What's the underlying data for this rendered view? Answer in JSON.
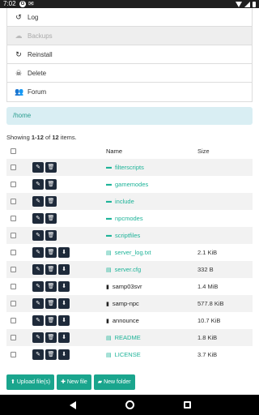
{
  "status_bar": {
    "time": "7:02",
    "g_badge": "G",
    "notif": "✉"
  },
  "menu": [
    {
      "icon": "history-icon",
      "glyph": "↺",
      "label": "Log",
      "disabled": false
    },
    {
      "icon": "cloud-icon",
      "glyph": "☁",
      "label": "Backups",
      "disabled": true
    },
    {
      "icon": "reinstall-icon",
      "glyph": "↻",
      "label": "Reinstall",
      "disabled": false
    },
    {
      "icon": "skull-icon",
      "glyph": "☠",
      "label": "Delete",
      "disabled": false
    },
    {
      "icon": "users-icon",
      "glyph": "👥",
      "label": "Forum",
      "disabled": false
    }
  ],
  "path": "/home",
  "showing": {
    "prefix": "Showing ",
    "range": "1-12",
    "of": " of ",
    "total": "12",
    "suffix": " items."
  },
  "table": {
    "headers": {
      "name": "Name",
      "size": "Size"
    },
    "rows": [
      {
        "type": "folder",
        "name": "filterscripts",
        "size": ""
      },
      {
        "type": "folder",
        "name": "gamemodes",
        "size": ""
      },
      {
        "type": "folder",
        "name": "include",
        "size": ""
      },
      {
        "type": "folder",
        "name": "npcmodes",
        "size": ""
      },
      {
        "type": "folder",
        "name": "scriptfiles",
        "size": ""
      },
      {
        "type": "file-text",
        "name": "server_log.txt",
        "size": "2.1 KiB"
      },
      {
        "type": "file-text",
        "name": "server.cfg",
        "size": "332 B"
      },
      {
        "type": "file",
        "name": "samp03svr",
        "size": "1.4 MiB"
      },
      {
        "type": "file",
        "name": "samp-npc",
        "size": "577.8 KiB"
      },
      {
        "type": "file",
        "name": "announce",
        "size": "10.7 KiB"
      },
      {
        "type": "file-text",
        "name": "README",
        "size": "1.8 KiB"
      },
      {
        "type": "file-text",
        "name": "LICENSE",
        "size": "3.7 KiB"
      }
    ]
  },
  "buttons": {
    "upload": "Upload file(s)",
    "new_file": "New file",
    "new_folder": "New folder"
  }
}
